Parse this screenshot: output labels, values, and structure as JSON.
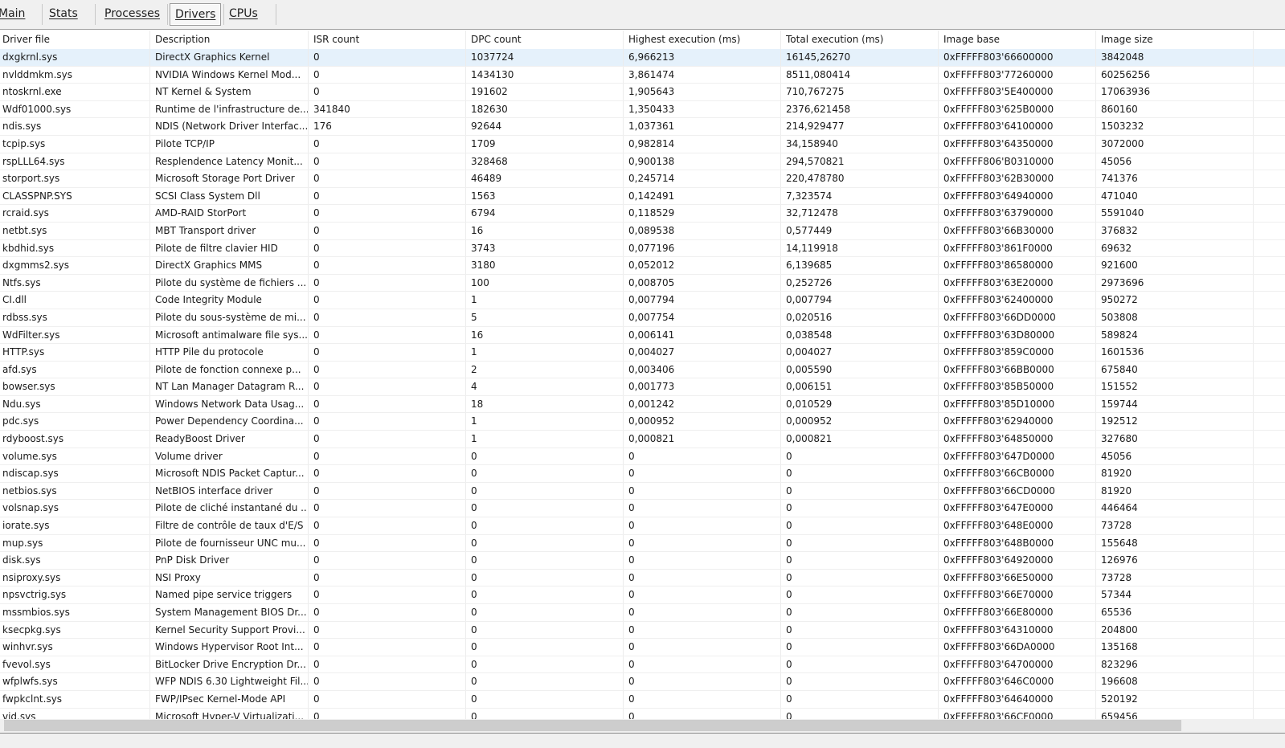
{
  "tabs": [
    "Main",
    "Stats",
    "Processes",
    "Drivers",
    "CPUs"
  ],
  "active_tab": "Drivers",
  "columns": [
    "Driver file",
    "Description",
    "ISR count",
    "DPC count",
    "Highest execution (ms)",
    "Total execution (ms)",
    "Image base",
    "Image size"
  ],
  "rows": [
    [
      "dxgkrnl.sys",
      "DirectX Graphics Kernel",
      "0",
      "1037724",
      "6,966213",
      "16145,26270",
      "0xFFFFF803'66600000",
      "3842048"
    ],
    [
      "nvlddmkm.sys",
      "NVIDIA Windows Kernel Mod...",
      "0",
      "1434130",
      "3,861474",
      "8511,080414",
      "0xFFFFF803'77260000",
      "60256256"
    ],
    [
      "ntoskrnl.exe",
      "NT Kernel & System",
      "0",
      "191602",
      "1,905643",
      "710,767275",
      "0xFFFFF803'5E400000",
      "17063936"
    ],
    [
      "Wdf01000.sys",
      "Runtime de l'infrastructure de...",
      "341840",
      "182630",
      "1,350433",
      "2376,621458",
      "0xFFFFF803'625B0000",
      "860160"
    ],
    [
      "ndis.sys",
      "NDIS (Network Driver Interfac...",
      "176",
      "92644",
      "1,037361",
      "214,929477",
      "0xFFFFF803'64100000",
      "1503232"
    ],
    [
      "tcpip.sys",
      "Pilote TCP/IP",
      "0",
      "1709",
      "0,982814",
      "34,158940",
      "0xFFFFF803'64350000",
      "3072000"
    ],
    [
      "rspLLL64.sys",
      "Resplendence Latency Monit...",
      "0",
      "328468",
      "0,900138",
      "294,570821",
      "0xFFFFF806'B0310000",
      "45056"
    ],
    [
      "storport.sys",
      "Microsoft Storage Port Driver",
      "0",
      "46489",
      "0,245714",
      "220,478780",
      "0xFFFFF803'62B30000",
      "741376"
    ],
    [
      "CLASSPNP.SYS",
      "SCSI Class System Dll",
      "0",
      "1563",
      "0,142491",
      "7,323574",
      "0xFFFFF803'64940000",
      "471040"
    ],
    [
      "rcraid.sys",
      "AMD-RAID StorPort",
      "0",
      "6794",
      "0,118529",
      "32,712478",
      "0xFFFFF803'63790000",
      "5591040"
    ],
    [
      "netbt.sys",
      "MBT Transport driver",
      "0",
      "16",
      "0,089538",
      "0,577449",
      "0xFFFFF803'66B30000",
      "376832"
    ],
    [
      "kbdhid.sys",
      "Pilote de filtre clavier HID",
      "0",
      "3743",
      "0,077196",
      "14,119918",
      "0xFFFFF803'861F0000",
      "69632"
    ],
    [
      "dxgmms2.sys",
      "DirectX Graphics MMS",
      "0",
      "3180",
      "0,052012",
      "6,139685",
      "0xFFFFF803'86580000",
      "921600"
    ],
    [
      "Ntfs.sys",
      "Pilote du système de fichiers ...",
      "0",
      "100",
      "0,008705",
      "0,252726",
      "0xFFFFF803'63E20000",
      "2973696"
    ],
    [
      "CI.dll",
      "Code Integrity Module",
      "0",
      "1",
      "0,007794",
      "0,007794",
      "0xFFFFF803'62400000",
      "950272"
    ],
    [
      "rdbss.sys",
      "Pilote du sous-système de mi...",
      "0",
      "5",
      "0,007754",
      "0,020516",
      "0xFFFFF803'66DD0000",
      "503808"
    ],
    [
      "WdFilter.sys",
      "Microsoft antimalware file sys...",
      "0",
      "16",
      "0,006141",
      "0,038548",
      "0xFFFFF803'63D80000",
      "589824"
    ],
    [
      "HTTP.sys",
      "HTTP Pile du protocole",
      "0",
      "1",
      "0,004027",
      "0,004027",
      "0xFFFFF803'859C0000",
      "1601536"
    ],
    [
      "afd.sys",
      "Pilote de fonction connexe p...",
      "0",
      "2",
      "0,003406",
      "0,005590",
      "0xFFFFF803'66BB0000",
      "675840"
    ],
    [
      "bowser.sys",
      "NT Lan Manager Datagram R...",
      "0",
      "4",
      "0,001773",
      "0,006151",
      "0xFFFFF803'85B50000",
      "151552"
    ],
    [
      "Ndu.sys",
      "Windows Network Data Usag...",
      "0",
      "18",
      "0,001242",
      "0,010529",
      "0xFFFFF803'85D10000",
      "159744"
    ],
    [
      "pdc.sys",
      "Power Dependency Coordina...",
      "0",
      "1",
      "0,000952",
      "0,000952",
      "0xFFFFF803'62940000",
      "192512"
    ],
    [
      "rdyboost.sys",
      "ReadyBoost Driver",
      "0",
      "1",
      "0,000821",
      "0,000821",
      "0xFFFFF803'64850000",
      "327680"
    ],
    [
      "volume.sys",
      "Volume driver",
      "0",
      "0",
      "0",
      "0",
      "0xFFFFF803'647D0000",
      "45056"
    ],
    [
      "ndiscap.sys",
      "Microsoft NDIS Packet Captur...",
      "0",
      "0",
      "0",
      "0",
      "0xFFFFF803'66CB0000",
      "81920"
    ],
    [
      "netbios.sys",
      "NetBIOS interface driver",
      "0",
      "0",
      "0",
      "0",
      "0xFFFFF803'66CD0000",
      "81920"
    ],
    [
      "volsnap.sys",
      "Pilote de cliché instantané du ...",
      "0",
      "0",
      "0",
      "0",
      "0xFFFFF803'647E0000",
      "446464"
    ],
    [
      "iorate.sys",
      "Filtre de contrôle de taux d'E/S",
      "0",
      "0",
      "0",
      "0",
      "0xFFFFF803'648E0000",
      "73728"
    ],
    [
      "mup.sys",
      "Pilote de fournisseur UNC mu...",
      "0",
      "0",
      "0",
      "0",
      "0xFFFFF803'648B0000",
      "155648"
    ],
    [
      "disk.sys",
      "PnP Disk Driver",
      "0",
      "0",
      "0",
      "0",
      "0xFFFFF803'64920000",
      "126976"
    ],
    [
      "nsiproxy.sys",
      "NSI Proxy",
      "0",
      "0",
      "0",
      "0",
      "0xFFFFF803'66E50000",
      "73728"
    ],
    [
      "npsvctrig.sys",
      "Named pipe service triggers",
      "0",
      "0",
      "0",
      "0",
      "0xFFFFF803'66E70000",
      "57344"
    ],
    [
      "mssmbios.sys",
      "System Management BIOS Dr...",
      "0",
      "0",
      "0",
      "0",
      "0xFFFFF803'66E80000",
      "65536"
    ],
    [
      "ksecpkg.sys",
      "Kernel Security Support Provi...",
      "0",
      "0",
      "0",
      "0",
      "0xFFFFF803'64310000",
      "204800"
    ],
    [
      "winhvr.sys",
      "Windows Hypervisor Root Int...",
      "0",
      "0",
      "0",
      "0",
      "0xFFFFF803'66DA0000",
      "135168"
    ],
    [
      "fvevol.sys",
      "BitLocker Drive Encryption Dr...",
      "0",
      "0",
      "0",
      "0",
      "0xFFFFF803'64700000",
      "823296"
    ],
    [
      "wfplwfs.sys",
      "WFP NDIS 6.30 Lightweight Fil...",
      "0",
      "0",
      "0",
      "0",
      "0xFFFFF803'646C0000",
      "196608"
    ],
    [
      "fwpkclnt.sys",
      "FWP/IPsec Kernel-Mode API",
      "0",
      "0",
      "0",
      "0",
      "0xFFFFF803'64640000",
      "520192"
    ],
    [
      "vid.sys",
      "Microsoft Hyper-V Virtualizati...",
      "0",
      "0",
      "0",
      "0",
      "0xFFFFF803'66CF0000",
      "659456"
    ]
  ],
  "selected_row": 0
}
